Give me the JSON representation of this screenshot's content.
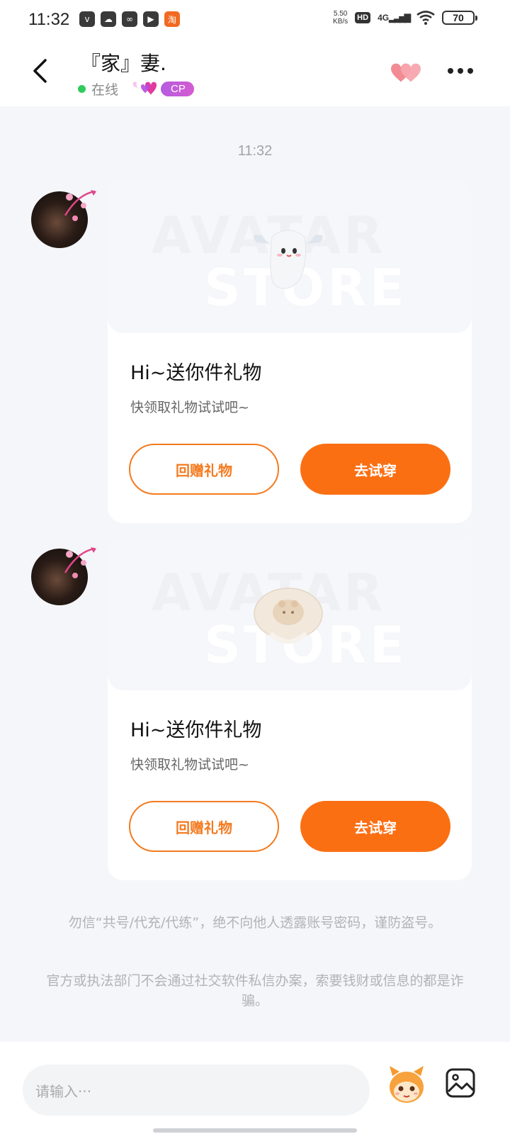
{
  "status_bar": {
    "time": "11:32",
    "net_speed_value": "5.50",
    "net_speed_unit": "KB/s",
    "hd": "HD",
    "network": "4G",
    "battery": "70"
  },
  "header": {
    "title": "『家』妻.",
    "status": "在线",
    "badge": "CP"
  },
  "chat": {
    "timestamp": "11:32",
    "messages": [
      {
        "watermark_top": "AVATAR",
        "watermark_bottom": "STORE",
        "title": "Hi~送你件礼物",
        "subtitle": "快领取礼物试试吧~",
        "return_gift_label": "回赠礼物",
        "try_on_label": "去试穿",
        "gift_icon": "ghost-icon"
      },
      {
        "watermark_top": "AVATAR",
        "watermark_bottom": "STORE",
        "title": "Hi~送你件礼物",
        "subtitle": "快领取礼物试试吧~",
        "return_gift_label": "回赠礼物",
        "try_on_label": "去试穿",
        "gift_icon": "pacifier-icon"
      }
    ]
  },
  "notices": [
    "勿信“共号/代充/代练”，绝不向他人透露账号密码，谨防盗号。",
    "官方或执法部门不会通过社交软件私信办案，索要钱财或信息的都是诈骗。"
  ],
  "input": {
    "placeholder": "请输入···"
  },
  "colors": {
    "accent": "#fb6f13",
    "online": "#2fcb5b",
    "cp_badge": "#c05ad8"
  }
}
